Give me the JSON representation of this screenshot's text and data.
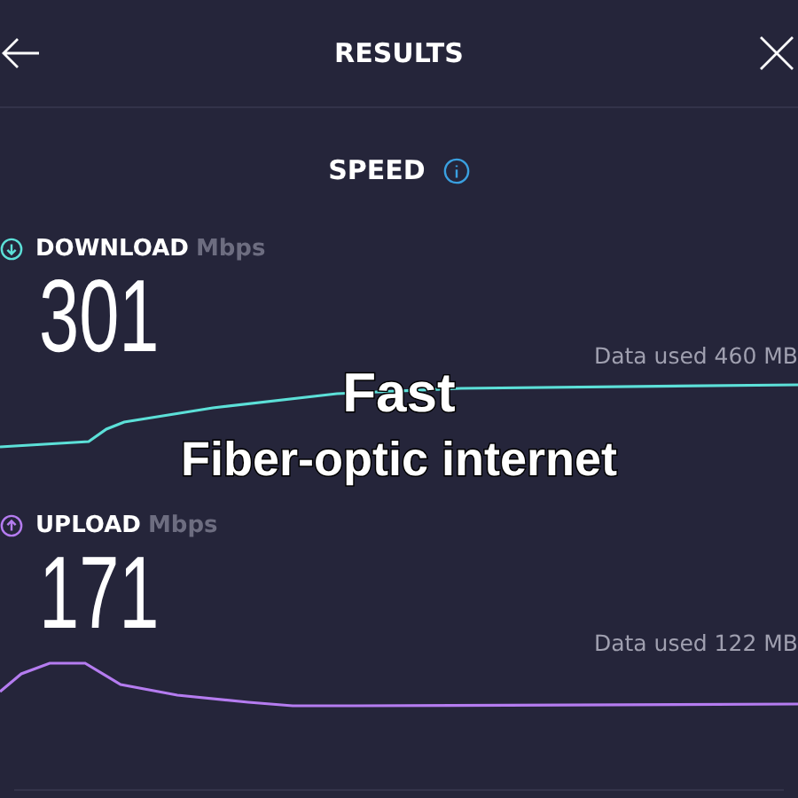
{
  "header": {
    "title": "RESULTS"
  },
  "section": {
    "title": "SPEED"
  },
  "metrics": [
    {
      "kind": "download",
      "label": "DOWNLOAD",
      "unit": "Mbps",
      "value": "301",
      "data_used": "Data used 460 MB",
      "color": "#5ce0d8"
    },
    {
      "kind": "upload",
      "label": "UPLOAD",
      "unit": "Mbps",
      "value": "171",
      "data_used": "Data used 122 MB",
      "color": "#b57cf0"
    }
  ],
  "caption": {
    "lines": [
      "Fast",
      "Fiber-optic internet"
    ]
  }
}
